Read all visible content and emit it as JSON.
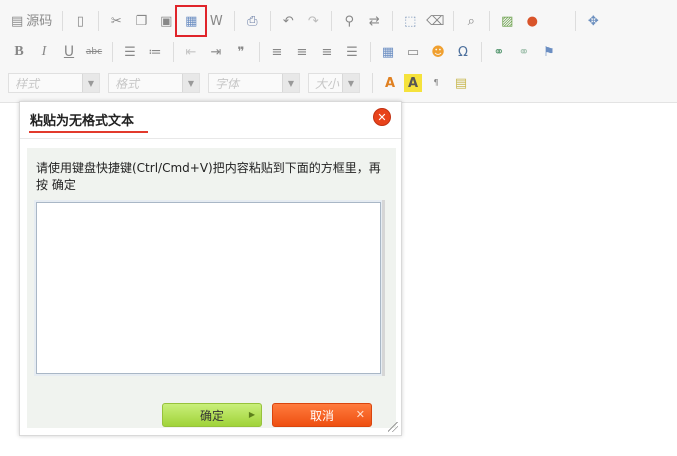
{
  "toolbar": {
    "source_label": "源码",
    "font_style_placeholder": "样式",
    "format_placeholder": "格式",
    "font_family_placeholder": "字体",
    "font_size_placeholder": "大小",
    "highlighted_button": "paste-as-plain-text",
    "highlight_color": "#e0242a"
  },
  "dialog": {
    "title": "粘贴为无格式文本",
    "title_underline_color": "#e23a2c",
    "instruction": "请使用键盘快捷键(Ctrl/Cmd+V)把内容粘贴到下面的方框里，再按 确定",
    "paste_area_value": "",
    "ok_label": "确定",
    "cancel_label": "取消",
    "ok_color": "#a0d339",
    "cancel_color": "#ee4f10",
    "close_glyph": "✕"
  }
}
